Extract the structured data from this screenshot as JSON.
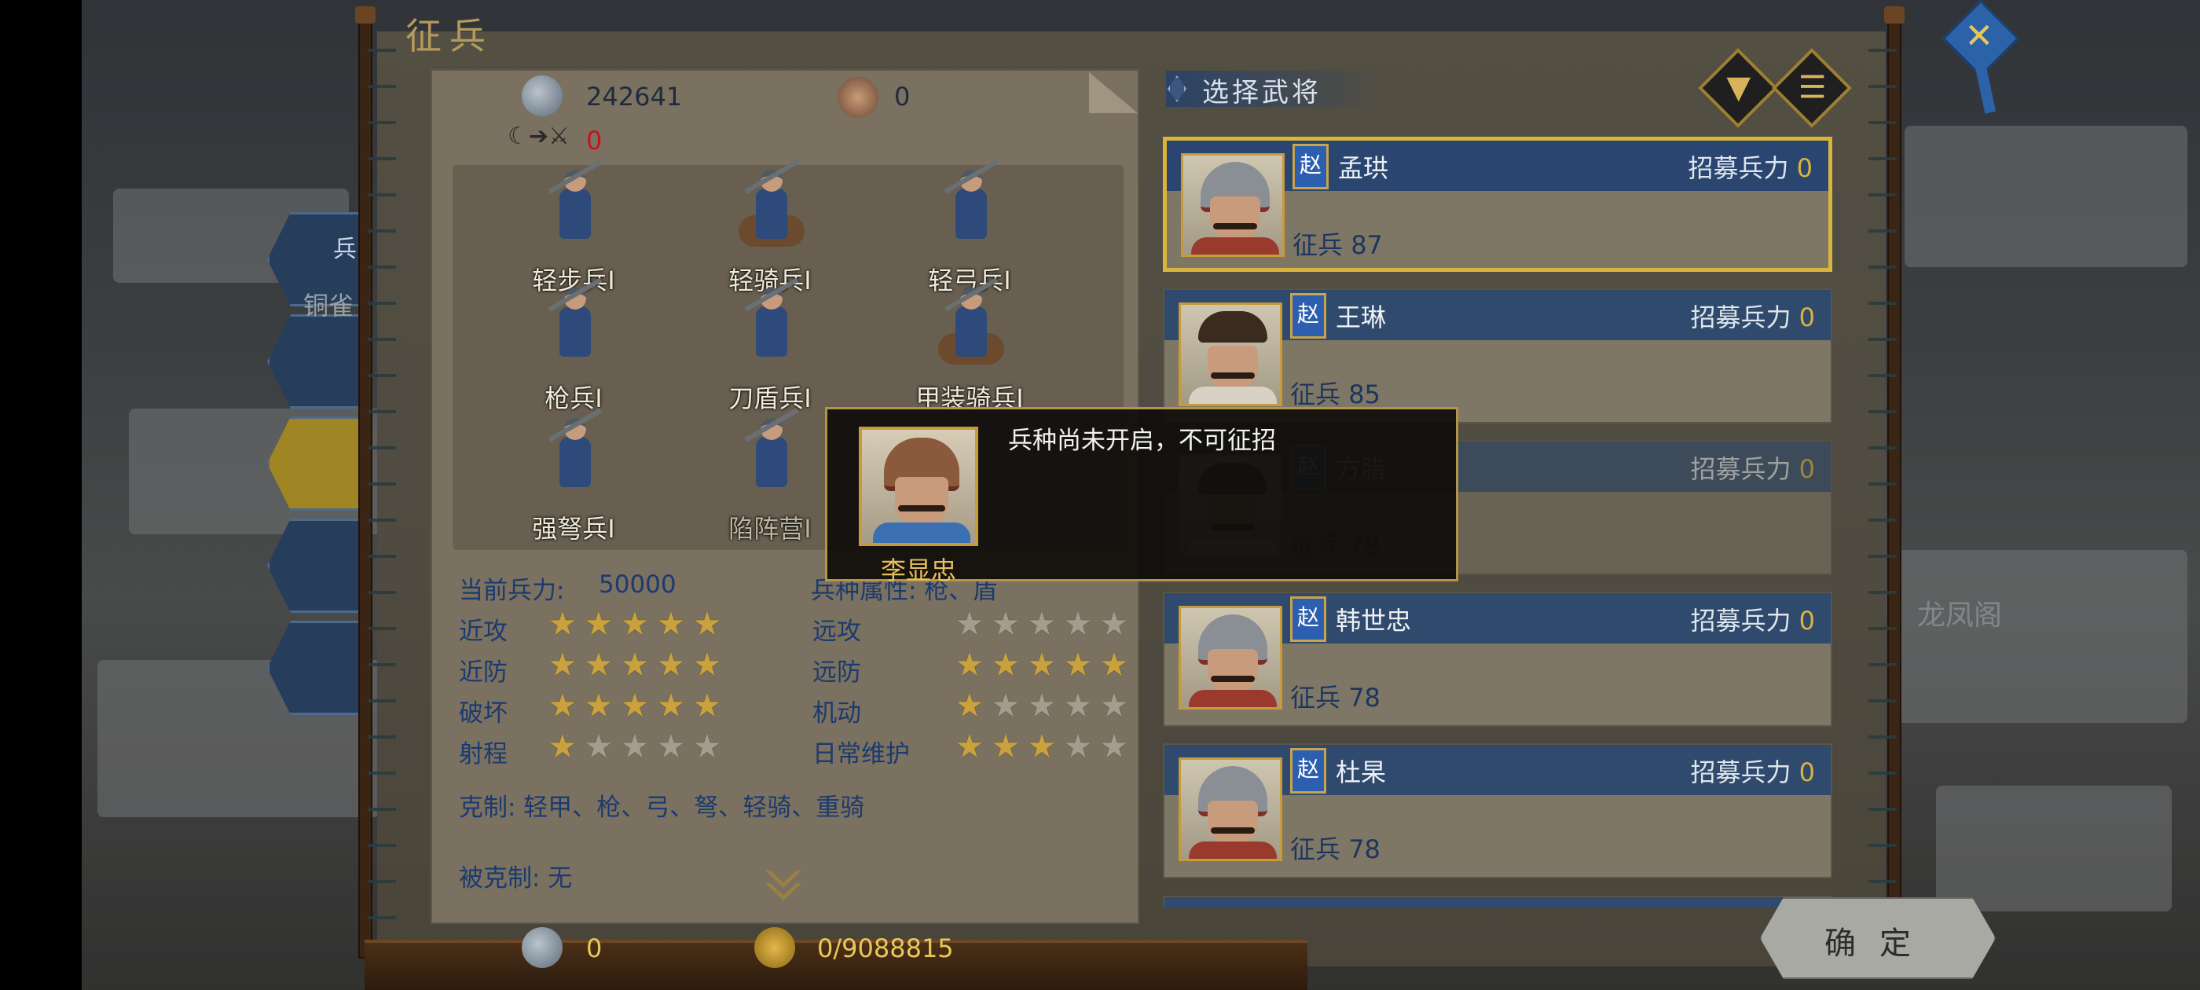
{
  "window": {
    "title": "征兵",
    "close_icon": "close-icon"
  },
  "background": {
    "side_tab_label": "兵",
    "side_tab_sub": "铜雀",
    "map_label": "龙凤阁"
  },
  "resources": {
    "troops": "242641",
    "officers": "0",
    "converted": "0",
    "bottom_troops": "0",
    "bottom_gold": "0/9088815"
  },
  "units": [
    {
      "label": "轻步兵Ⅰ",
      "cavalry": false,
      "dim": false
    },
    {
      "label": "轻骑兵Ⅰ",
      "cavalry": true,
      "dim": false
    },
    {
      "label": "轻弓兵Ⅰ",
      "cavalry": false,
      "dim": false
    },
    {
      "label": "枪兵Ⅰ",
      "cavalry": false,
      "dim": false
    },
    {
      "label": "刀盾兵Ⅰ",
      "cavalry": false,
      "dim": false
    },
    {
      "label": "甲装骑兵Ⅰ",
      "cavalry": true,
      "dim": false
    },
    {
      "label": "强弩兵Ⅰ",
      "cavalry": false,
      "dim": false
    },
    {
      "label": "陷阵营Ⅰ",
      "cavalry": false,
      "dim": true
    }
  ],
  "stats": {
    "current_label": "当前兵力:",
    "current_value": "50000",
    "attr_label": "兵种属性: 枪、盾",
    "rows": [
      {
        "left_label": "近攻",
        "left_stars": 5,
        "right_label": "远攻",
        "right_stars": 0
      },
      {
        "left_label": "近防",
        "left_stars": 5,
        "right_label": "远防",
        "right_stars": 5
      },
      {
        "left_label": "破坏",
        "left_stars": 5,
        "right_label": "机动",
        "right_stars": 1
      },
      {
        "left_label": "射程",
        "left_stars": 1,
        "right_label": "日常维护",
        "right_stars": 3
      }
    ],
    "counters": "克制: 轻甲、枪、弓、弩、轻骑、重骑",
    "countered_by": "被克制: 无"
  },
  "picker": {
    "title": "选择武将",
    "filter_icon": "filter-icon",
    "list_icon": "list-icon"
  },
  "generals": [
    {
      "faction": "赵",
      "name": "孟珙",
      "recruit_label": "招募兵力",
      "recruit_value": "0",
      "troops_label": "征兵",
      "troops": "87",
      "selected": true,
      "helmet": true
    },
    {
      "faction": "赵",
      "name": "王琳",
      "recruit_label": "招募兵力",
      "recruit_value": "0",
      "troops_label": "征兵",
      "troops": "85",
      "selected": false,
      "helmet": false
    },
    {
      "faction": "赵",
      "name": "方腊",
      "recruit_label": "招募兵力",
      "recruit_value": "0",
      "troops_label": "征兵",
      "troops": "78",
      "selected": false,
      "helmet": false
    },
    {
      "faction": "赵",
      "name": "韩世忠",
      "recruit_label": "招募兵力",
      "recruit_value": "0",
      "troops_label": "征兵",
      "troops": "78",
      "selected": false,
      "helmet": true
    },
    {
      "faction": "赵",
      "name": "杜杲",
      "recruit_label": "招募兵力",
      "recruit_value": "0",
      "troops_label": "征兵",
      "troops": "78",
      "selected": false,
      "helmet": true
    }
  ],
  "confirm_label": "确定",
  "tooltip": {
    "name": "李显忠",
    "message": "兵种尚未开启，不可征招"
  }
}
